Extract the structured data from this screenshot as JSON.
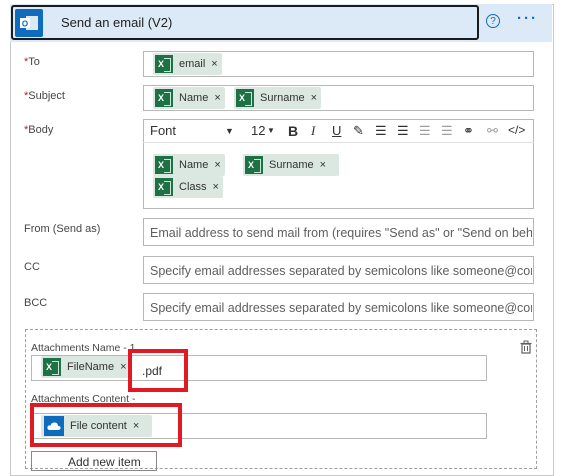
{
  "header": {
    "title": "Send an email (V2)",
    "help_glyph": "?",
    "more_glyph": "···"
  },
  "fields": {
    "to": {
      "label": "To",
      "tokens": [
        "email"
      ]
    },
    "subject": {
      "label": "Subject",
      "tokens": [
        "Name",
        "Surname"
      ]
    },
    "body": {
      "label": "Body",
      "toolbar": {
        "font": "Font",
        "size": "12",
        "bold": "B",
        "italic": "I",
        "underline": "U"
      },
      "tokens": [
        "Name",
        "Surname",
        "Class"
      ]
    },
    "from": {
      "label": "From (Send as)",
      "placeholder": "Email address to send mail from (requires \"Send as\" or \"Send on beh"
    },
    "cc": {
      "label": "CC",
      "placeholder": "Specify email addresses separated by semicolons like someone@con"
    },
    "bcc": {
      "label": "BCC",
      "placeholder": "Specify email addresses separated by semicolons like someone@con"
    }
  },
  "attachments": {
    "name_label": "Attachments Name - 1",
    "name_token": "FileName",
    "name_suffix": ".pdf",
    "content_label": "Attachments Content -",
    "content_token": "File content",
    "add_item_label": "Add new item"
  },
  "remove_glyph": "×",
  "required_mark": "*",
  "colors": {
    "header_bg": "#dce9f7",
    "excel_green": "#1e7145",
    "token_bg": "#dbe8e2",
    "highlight_red": "#e01a22",
    "accent_blue": "#0f6cbd"
  }
}
